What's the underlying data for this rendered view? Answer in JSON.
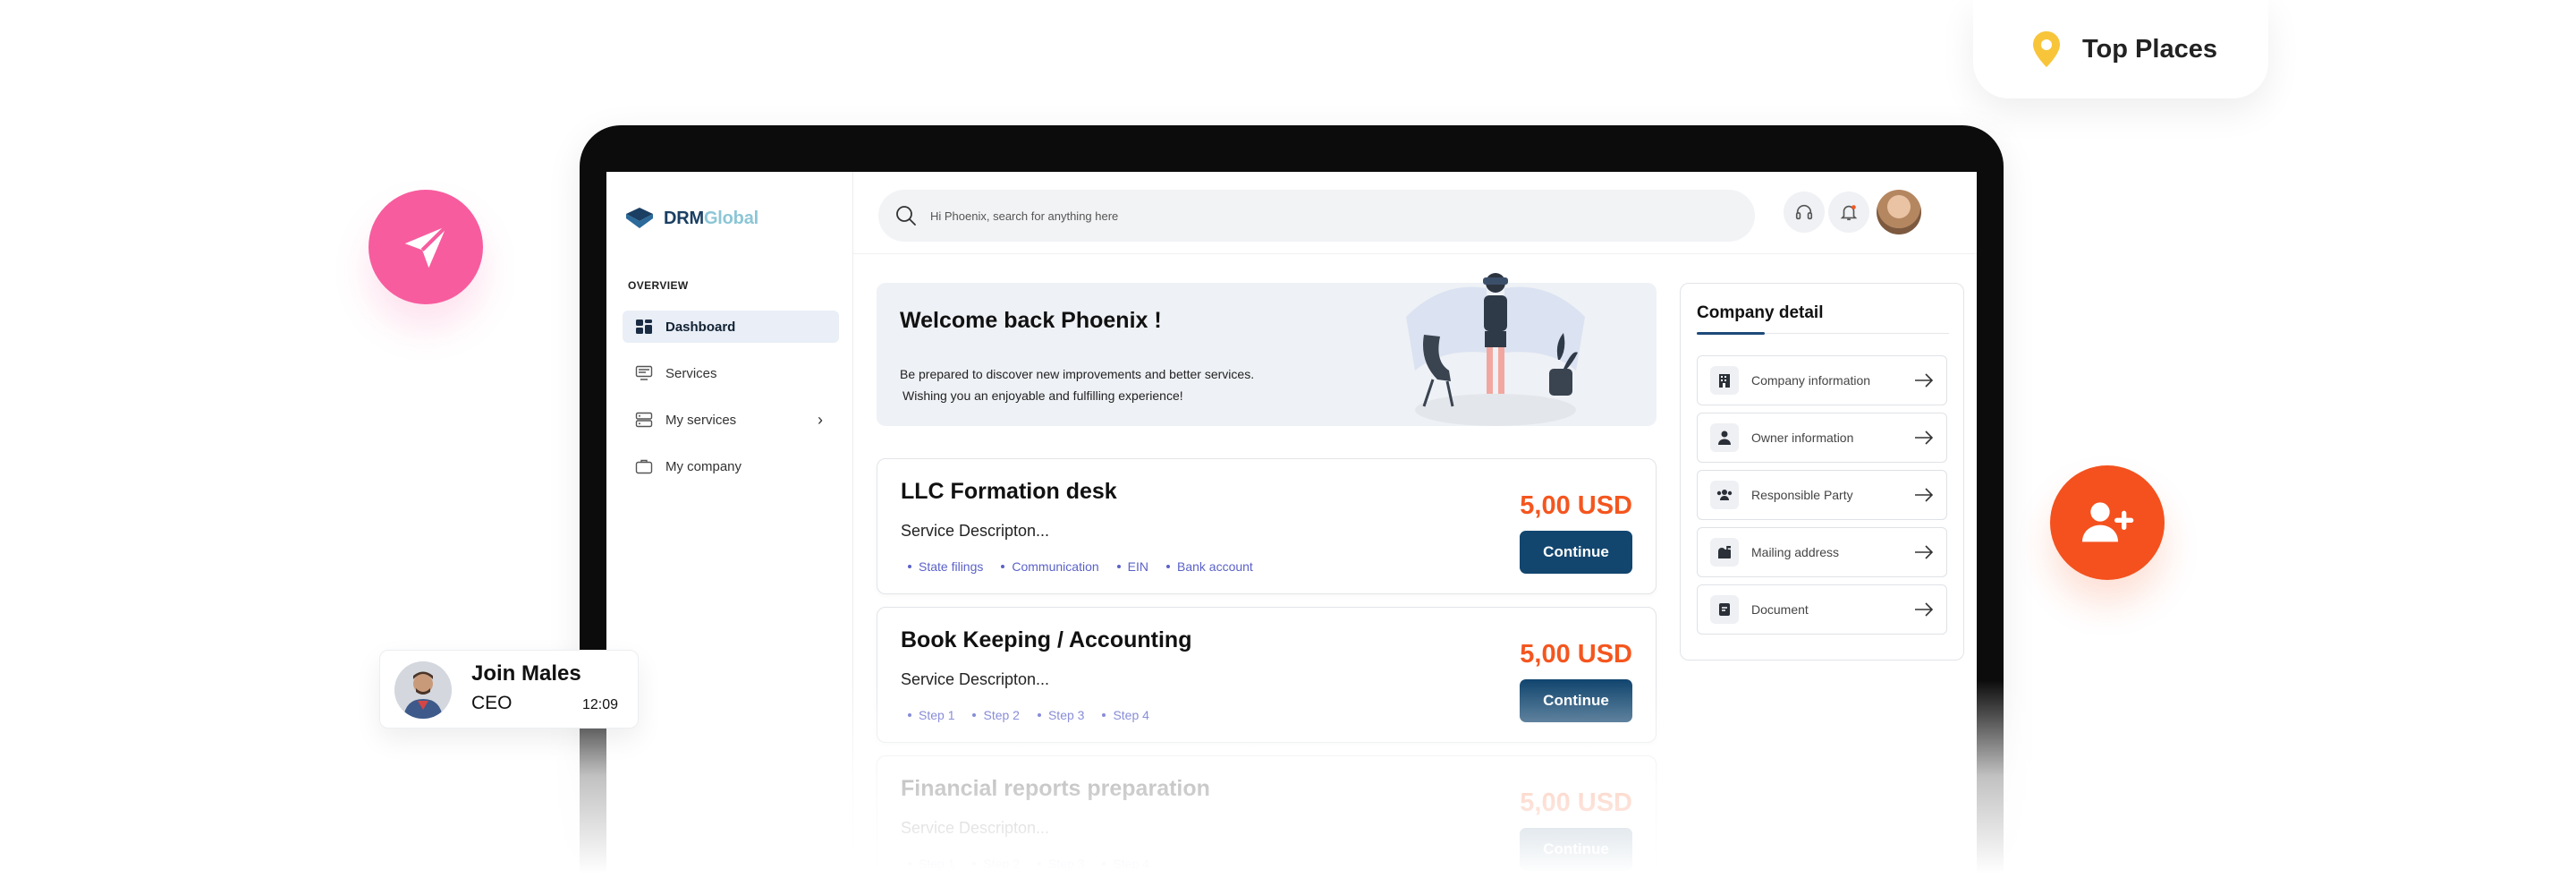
{
  "brand": {
    "name_primary": "DRM",
    "name_secondary": "Global"
  },
  "sidebar": {
    "section_label": "OVERVIEW",
    "items": [
      {
        "label": "Dashboard",
        "icon": "dashboard-icon",
        "active": true
      },
      {
        "label": "Services",
        "icon": "services-icon"
      },
      {
        "label": "My services",
        "icon": "my-services-icon",
        "has_chevron": true
      },
      {
        "label": "My company",
        "icon": "briefcase-icon"
      }
    ]
  },
  "search": {
    "placeholder": "Hi Phoenix, search for anything here"
  },
  "topbar": {
    "icons": [
      "headset-icon",
      "bell-icon",
      "user-avatar"
    ]
  },
  "welcome": {
    "title": "Welcome back Phoenix !",
    "line1": "Be prepared to discover new improvements and better services.",
    "line2": "Wishing you an enjoyable and fulfilling experience!"
  },
  "services": [
    {
      "title": "LLC Formation desk",
      "description": "Service Descripton...",
      "price": "5,00 USD",
      "button": "Continue",
      "tags": [
        "State filings",
        "Communication",
        "EIN",
        "Bank account"
      ]
    },
    {
      "title": "Book Keeping / Accounting",
      "description": "Service Descripton...",
      "price": "5,00 USD",
      "button": "Continue",
      "tags": [
        "Step 1",
        "Step 2",
        "Step 3",
        "Step 4"
      ]
    },
    {
      "title": "Financial reports preparation",
      "description": "Service Descripton...",
      "price": "5,00 USD",
      "button": "Continue",
      "tags": [
        "Step 1",
        "Step 2",
        "Step 3",
        "Step 4"
      ]
    }
  ],
  "company": {
    "title": "Company detail",
    "items": [
      {
        "label": "Company information",
        "icon": "building-icon"
      },
      {
        "label": "Owner information",
        "icon": "person-icon"
      },
      {
        "label": "Responsible Party",
        "icon": "group-icon"
      },
      {
        "label": "Mailing address",
        "icon": "mailbox-icon"
      },
      {
        "label": "Document",
        "icon": "document-icon"
      }
    ]
  },
  "widgets": {
    "top_places": "Top Places",
    "join": {
      "name": "Join Males",
      "role": "CEO",
      "time": "12:09"
    }
  },
  "colors": {
    "accent_orange": "#f4561f",
    "button_navy": "#12466f",
    "pink": "#f75c9e",
    "tag_purple": "#5b62c8"
  }
}
